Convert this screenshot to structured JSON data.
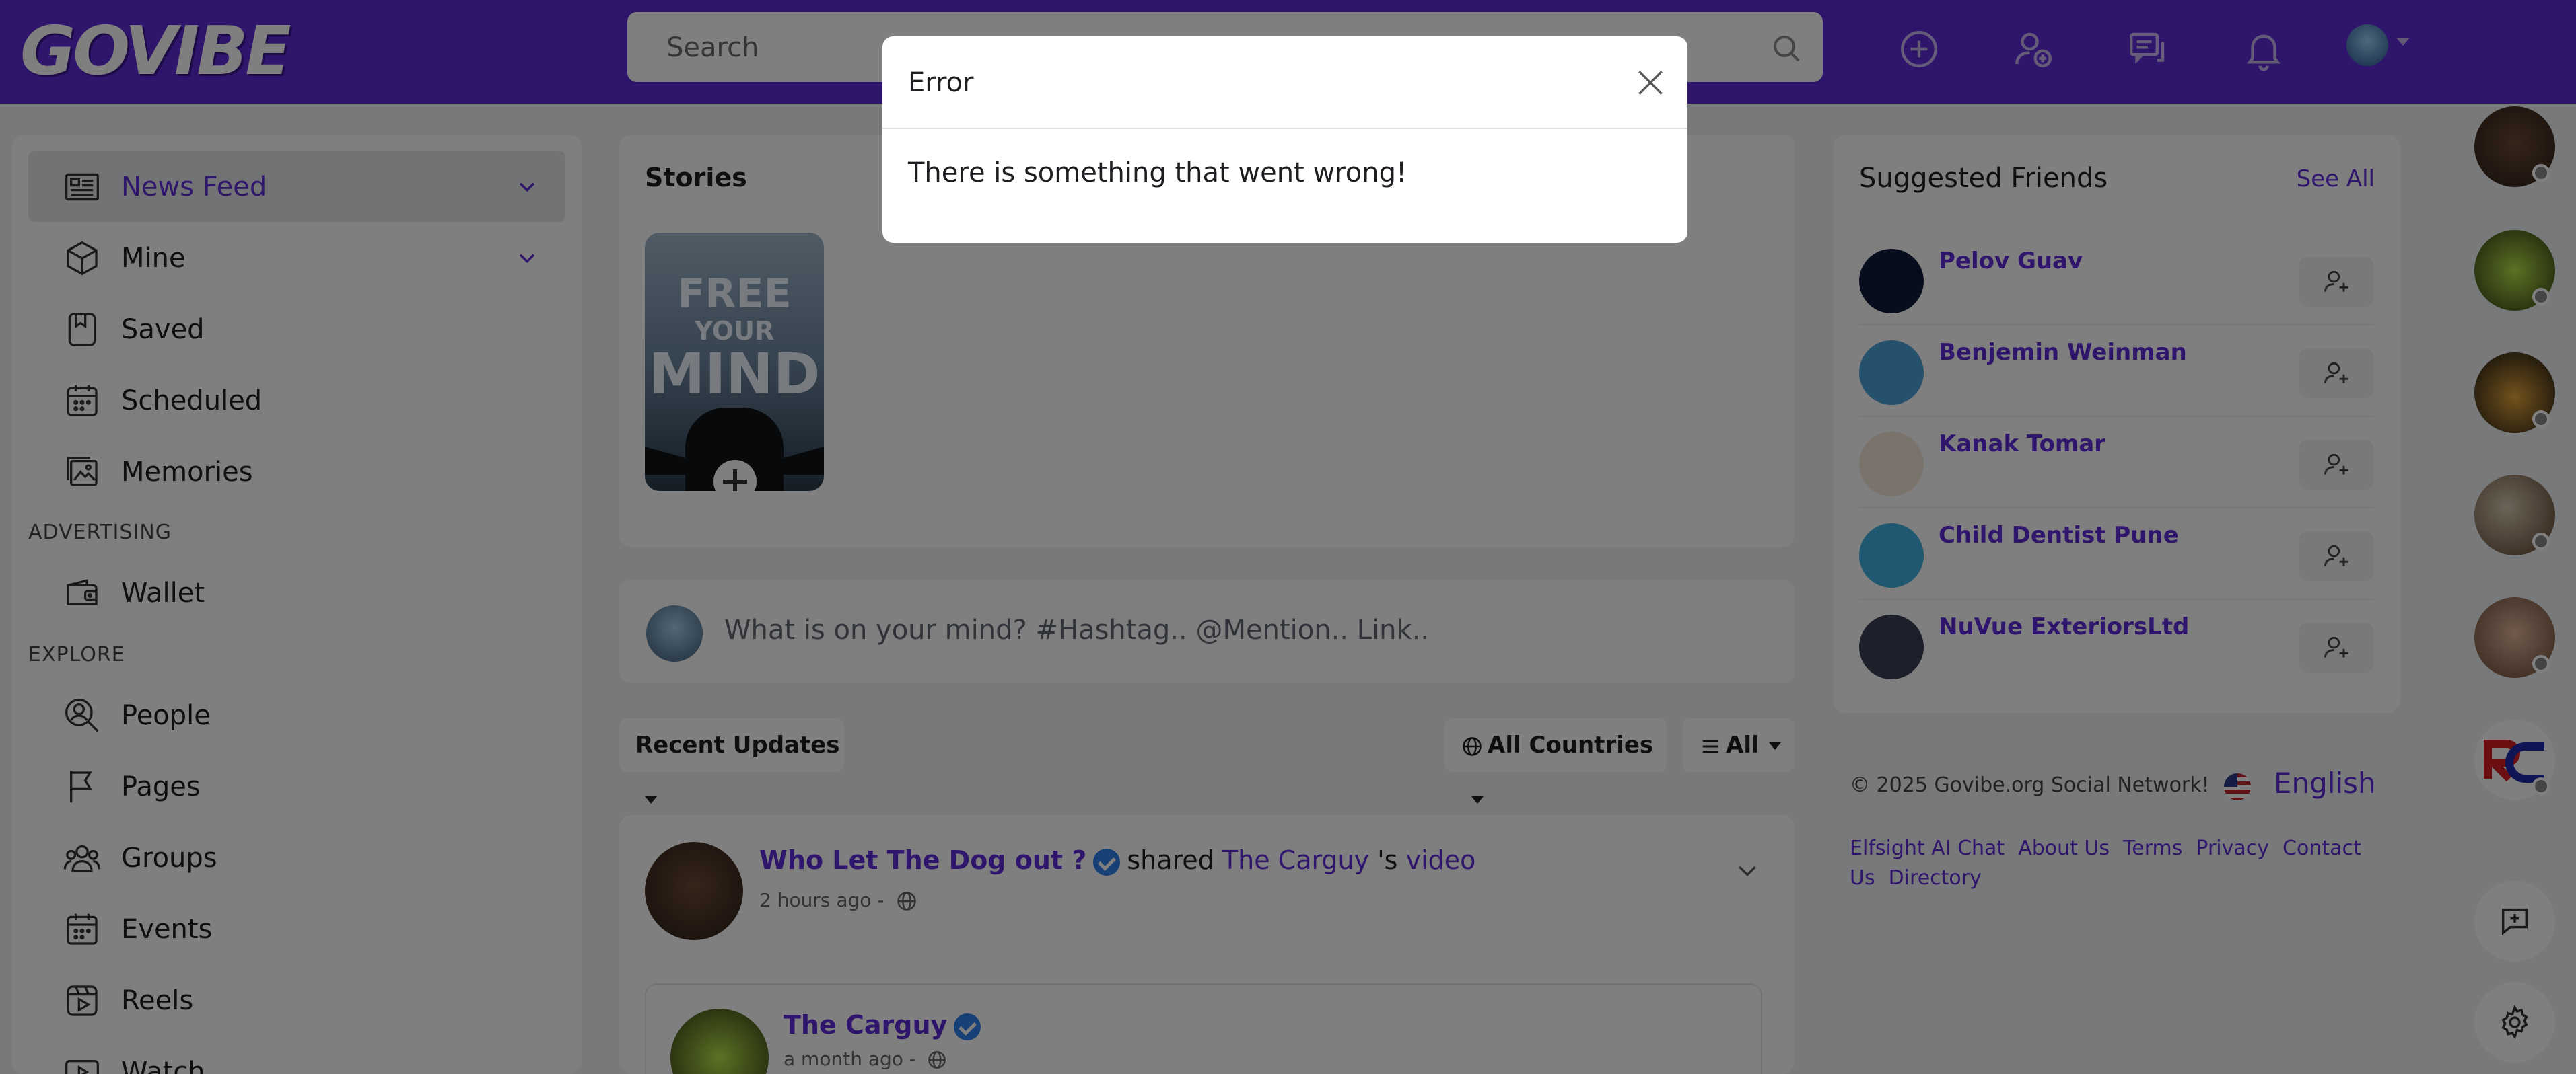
{
  "app": {
    "logo_text": "GOVIBE"
  },
  "header": {
    "search_placeholder": "Search"
  },
  "sidebar": {
    "items": [
      {
        "label": "News Feed"
      },
      {
        "label": "Mine"
      },
      {
        "label": "Saved"
      },
      {
        "label": "Scheduled"
      },
      {
        "label": "Memories"
      },
      {
        "label": "Wallet"
      },
      {
        "label": "People"
      },
      {
        "label": "Pages"
      },
      {
        "label": "Groups"
      },
      {
        "label": "Events"
      },
      {
        "label": "Reels"
      },
      {
        "label": "Watch"
      }
    ],
    "sections": {
      "advertising": "ADVERTISING",
      "explore": "EXPLORE"
    }
  },
  "stories": {
    "title": "Stories",
    "story_text": {
      "line1": "FREE",
      "line2": "YOUR",
      "line3": "MIND"
    }
  },
  "composer": {
    "placeholder": "What is on your mind? #Hashtag.. @Mention.. Link.."
  },
  "filters": {
    "recent": "Recent Updates",
    "countries": "All Countries",
    "all": "All"
  },
  "post": {
    "author": "Who Let The Dog out ?",
    "action": "shared",
    "target": "The Carguy",
    "possessive": "'s",
    "object": "video",
    "time": "2 hours ago -",
    "shared": {
      "author": "The Carguy",
      "time": "a month ago -"
    }
  },
  "suggested": {
    "title": "Suggested Friends",
    "see_all": "See All",
    "people": [
      {
        "name": "Pelov Guav",
        "color": "#0e1a3a"
      },
      {
        "name": "Benjemin Weinman",
        "color": "#4aa3d8"
      },
      {
        "name": "Kanak Tomar",
        "color": "#f3e7d8"
      },
      {
        "name": "Child Dentist Pune",
        "color": "#3fb1e0"
      },
      {
        "name": "NuVue ExteriorsLtd",
        "color": "#3a3f55"
      }
    ]
  },
  "footer": {
    "copyright": "© 2025 Govibe.org Social Network!",
    "language": "English",
    "links": [
      "Elfsight AI Chat",
      "About Us",
      "Terms",
      "Privacy",
      "Contact Us",
      "Directory"
    ]
  },
  "modal": {
    "title": "Error",
    "message": "There is something that went wrong!"
  },
  "colors": {
    "brand": "#5e2bd9",
    "link": "#5e2bd9",
    "verified": "#2f80ed"
  }
}
